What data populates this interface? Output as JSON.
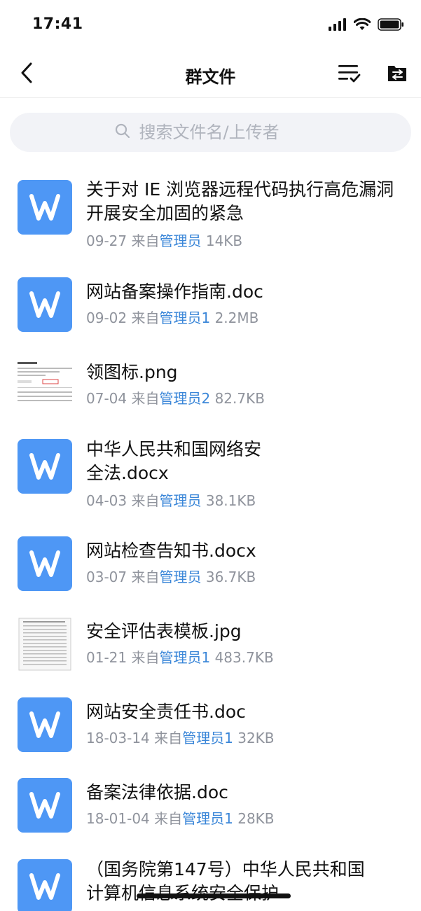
{
  "status_bar": {
    "time": "17:41"
  },
  "nav": {
    "title": "群文件"
  },
  "search": {
    "placeholder": "搜索文件名/上传者"
  },
  "files": [
    {
      "name": "关于对 IE 浏览器远程代码执行高危漏洞开展安全加固的紧急",
      "date": "09-27",
      "from": "来自",
      "uploader": "管理员",
      "size": "14KB",
      "type": "doc"
    },
    {
      "name": "网站备案操作指南.doc",
      "date": "09-02",
      "from": "来自",
      "uploader": "管理员1",
      "size": "2.2MB",
      "type": "doc"
    },
    {
      "name": "领图标.png",
      "date": "07-04",
      "from": "来自",
      "uploader": "管理员2",
      "size": "82.7KB",
      "type": "image"
    },
    {
      "name": "中华人民共和国网络安全法.docx",
      "date": "04-03",
      "from": "来自",
      "uploader": "管理员",
      "size": "38.1KB",
      "type": "doc"
    },
    {
      "name": "网站检查告知书.docx",
      "date": "03-07",
      "from": "来自",
      "uploader": "管理员",
      "size": "36.7KB",
      "type": "doc"
    },
    {
      "name": "安全评估表模板.jpg",
      "date": "01-21",
      "from": "来自",
      "uploader": "管理员1",
      "size": "483.7KB",
      "type": "image"
    },
    {
      "name": "网站安全责任书.doc",
      "date": "18-03-14",
      "from": "来自",
      "uploader": "管理员1",
      "size": "32KB",
      "type": "doc"
    },
    {
      "name": "备案法律依据.doc",
      "date": "18-01-04",
      "from": "来自",
      "uploader": "管理员1",
      "size": "28KB",
      "type": "doc"
    },
    {
      "name": "（国务院第147号）中华人民共和国计算机信息系统安全保护",
      "date": "",
      "from": "",
      "uploader": "",
      "size": "",
      "type": "doc"
    }
  ]
}
